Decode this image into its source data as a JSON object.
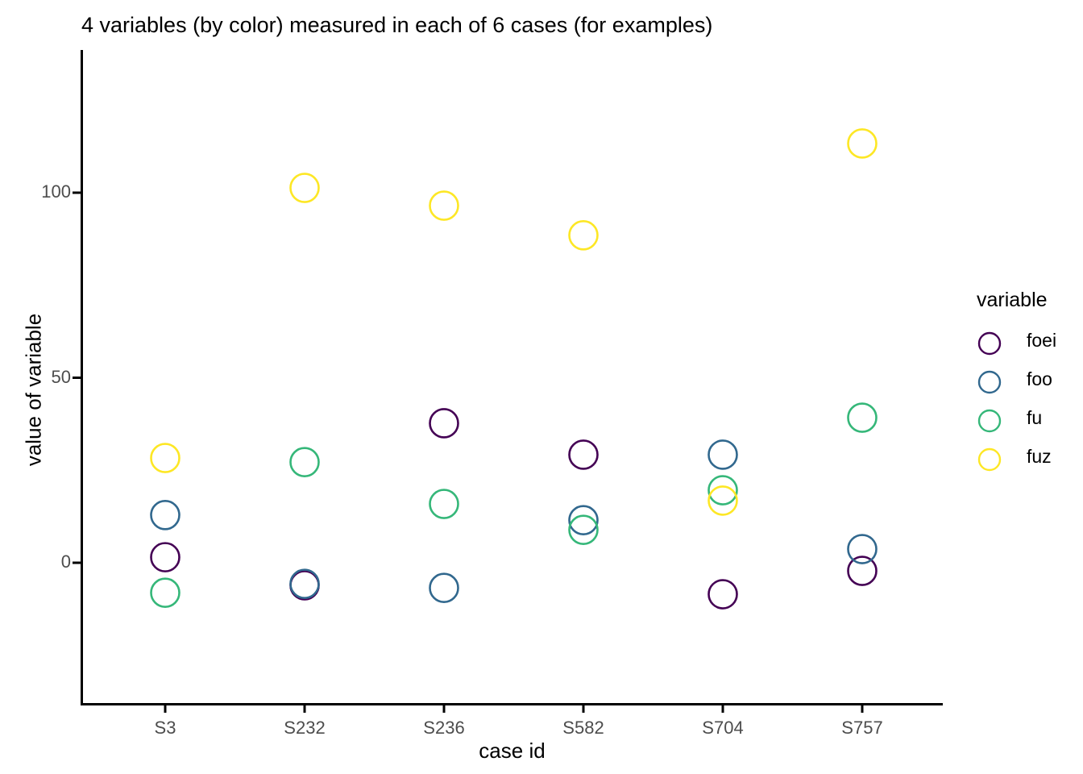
{
  "chart_data": {
    "type": "scatter",
    "title": "4 variables (by color) measured in each of 6 cases (for examples)",
    "xlabel": "case id",
    "ylabel": "value of variable",
    "legend_title": "variable",
    "legend_position": "right",
    "grid": false,
    "categories": [
      "S3",
      "S232",
      "S236",
      "S582",
      "S704",
      "S757"
    ],
    "ytick_labels": [
      "0",
      "50",
      "100"
    ],
    "yticks": [
      0,
      50,
      100
    ],
    "ylim": [
      -40,
      135
    ],
    "marker": "open-circle",
    "series": [
      {
        "name": "foei",
        "color": "#440154",
        "values": [
          1.5,
          -6.1,
          37.7,
          29.2,
          -8.5,
          -2.2
        ]
      },
      {
        "name": "foo",
        "color": "#31688E",
        "values": [
          12.9,
          -5.7,
          -6.8,
          11.5,
          29.2,
          3.7
        ]
      },
      {
        "name": "fu",
        "color": "#35B779",
        "values": [
          -8.1,
          27.2,
          15.9,
          8.9,
          19.6,
          39.2
        ]
      },
      {
        "name": "fuz",
        "color": "#FDE725",
        "values": [
          28.3,
          101.3,
          96.5,
          88.5,
          16.8,
          113.3
        ]
      }
    ]
  },
  "colors": {
    "axis_line": "#000000",
    "tick_label": "#4d4d4d",
    "title": "#000000",
    "background": "#ffffff"
  }
}
